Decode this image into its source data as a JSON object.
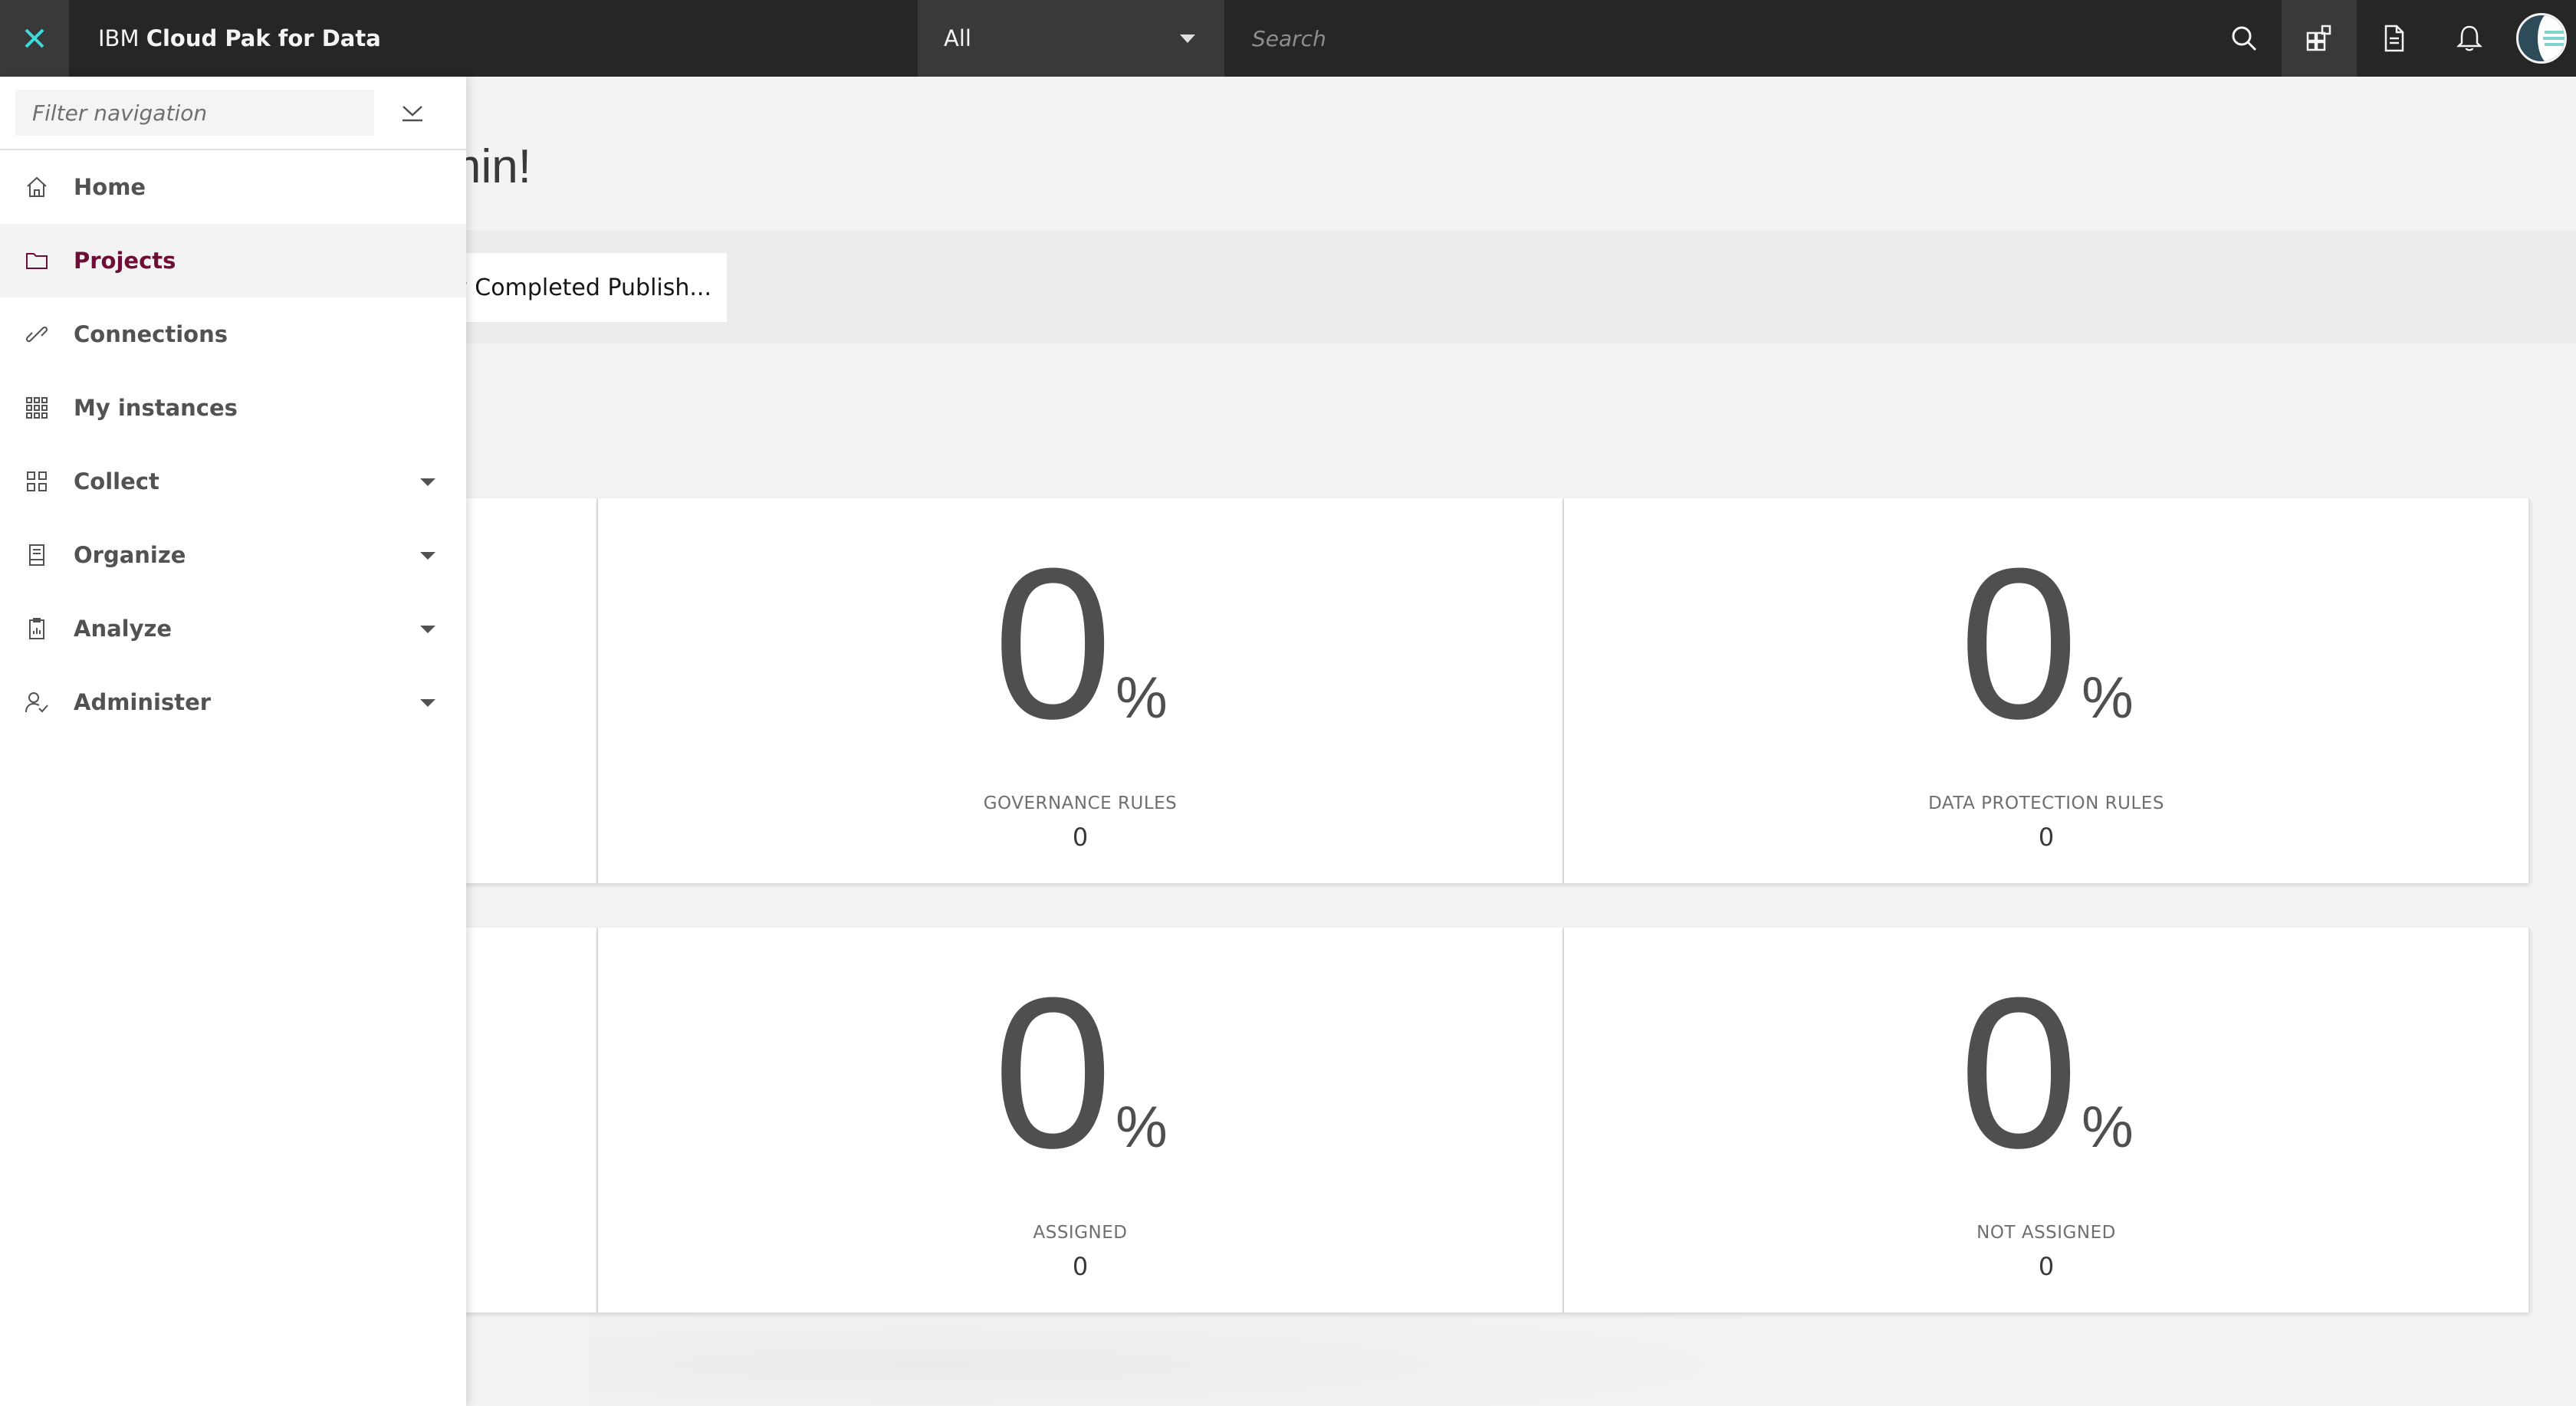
{
  "topbar": {
    "brand_prefix": "IBM",
    "brand_name": "Cloud Pak for Data",
    "scope_value": "All",
    "search_placeholder": "Search"
  },
  "main": {
    "welcome": "come admin!",
    "tab_label": "My Completed Publish..."
  },
  "cards": {
    "row1": [
      {
        "number": "0",
        "unit": "%",
        "label": "GOVERNANCE RULES",
        "value": "0"
      },
      {
        "number": "0",
        "unit": "%",
        "label": "DATA PROTECTION RULES",
        "value": "0"
      }
    ],
    "row2": [
      {
        "number": "0",
        "unit": "%",
        "label": "ASSIGNED",
        "value": "0"
      },
      {
        "number": "0",
        "unit": "%",
        "label": "NOT ASSIGNED",
        "value": "0"
      }
    ]
  },
  "sidenav": {
    "filter_placeholder": "Filter navigation",
    "items": [
      {
        "label": "Home",
        "icon": "home-icon"
      },
      {
        "label": "Projects",
        "icon": "folder-icon",
        "active": true
      },
      {
        "label": "Connections",
        "icon": "link-icon"
      },
      {
        "label": "My instances",
        "icon": "grid-icon"
      },
      {
        "label": "Collect",
        "icon": "apps-icon"
      },
      {
        "label": "Organize",
        "icon": "catalog-icon"
      },
      {
        "label": "Analyze",
        "icon": "report-icon"
      },
      {
        "label": "Administer",
        "icon": "user-admin-icon"
      }
    ]
  },
  "colors": {
    "topbar": "#262626",
    "accent_close": "#3ddbd9",
    "active_nav": "#6e0d36"
  }
}
